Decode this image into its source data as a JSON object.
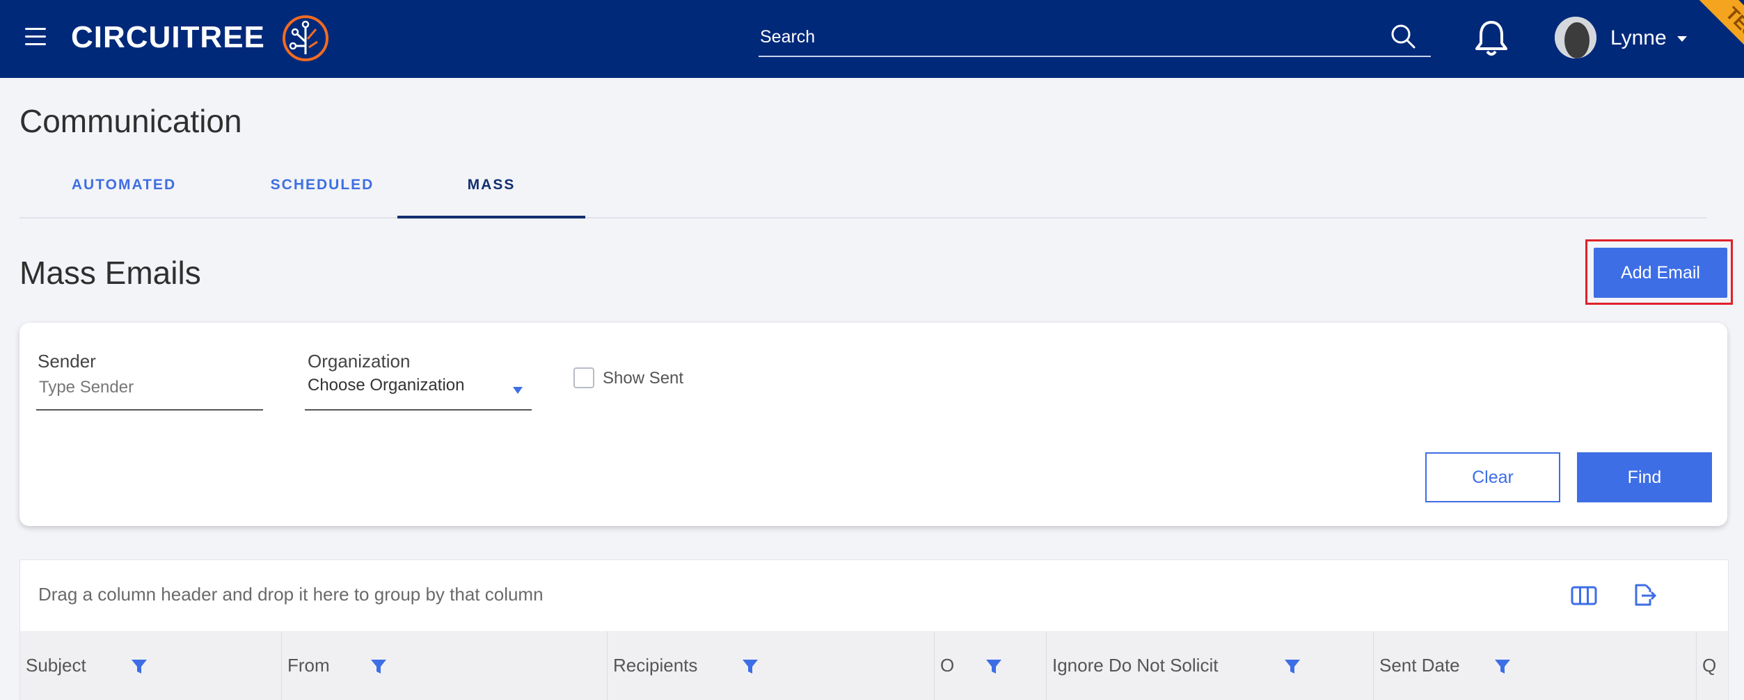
{
  "header": {
    "logo_text": "CIRCUITREE",
    "search_placeholder": "Search",
    "user_name": "Lynne",
    "env_badge": "TEST"
  },
  "page": {
    "title": "Communication",
    "tabs": [
      {
        "label": "AUTOMATED",
        "active": false
      },
      {
        "label": "SCHEDULED",
        "active": false
      },
      {
        "label": "MASS",
        "active": true
      }
    ],
    "section_title": "Mass Emails",
    "add_email_label": "Add Email"
  },
  "filters": {
    "sender_label": "Sender",
    "sender_placeholder": "Type Sender",
    "organization_label": "Organization",
    "organization_value": "Choose Organization",
    "show_sent_label": "Show Sent",
    "show_sent_checked": false,
    "clear_label": "Clear",
    "find_label": "Find"
  },
  "grid": {
    "group_hint": "Drag a column header and drop it here to group by that column",
    "columns": [
      {
        "label": "Subject"
      },
      {
        "label": "From"
      },
      {
        "label": "Recipients"
      },
      {
        "label": "O"
      },
      {
        "label": "Ignore Do Not Solicit"
      },
      {
        "label": "Sent Date"
      },
      {
        "label": "Q"
      }
    ]
  },
  "colors": {
    "navbar": "#00297a",
    "primary": "#3d6ee5",
    "highlight_outline": "#e0202a",
    "badge": "#f4a41e"
  }
}
